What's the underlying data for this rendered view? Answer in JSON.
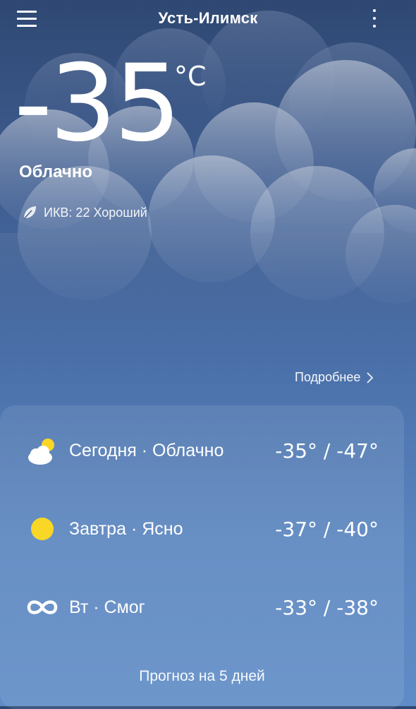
{
  "header": {
    "city": "Усть-Илимск"
  },
  "current": {
    "temperature": "-35",
    "unit": "°C",
    "condition": "Облачно",
    "aqi_text": "ИКВ: 22 Хороший"
  },
  "details_link": "Подробнее",
  "forecast": [
    {
      "label": "Сегодня · Облачно",
      "range": "-35° / -47°",
      "icon": "cloud-sun-icon"
    },
    {
      "label": "Завтра · Ясно",
      "range": "-37° / -40°",
      "icon": "sun-icon"
    },
    {
      "label": "Вт · Смог",
      "range": "-33° / -38°",
      "icon": "smog-icon"
    }
  ],
  "five_day_label": "Прогноз на 5 дней",
  "colors": {
    "sun": "#f9d727",
    "background_top": "#2f4873",
    "background_bottom": "#5f8cc6"
  }
}
